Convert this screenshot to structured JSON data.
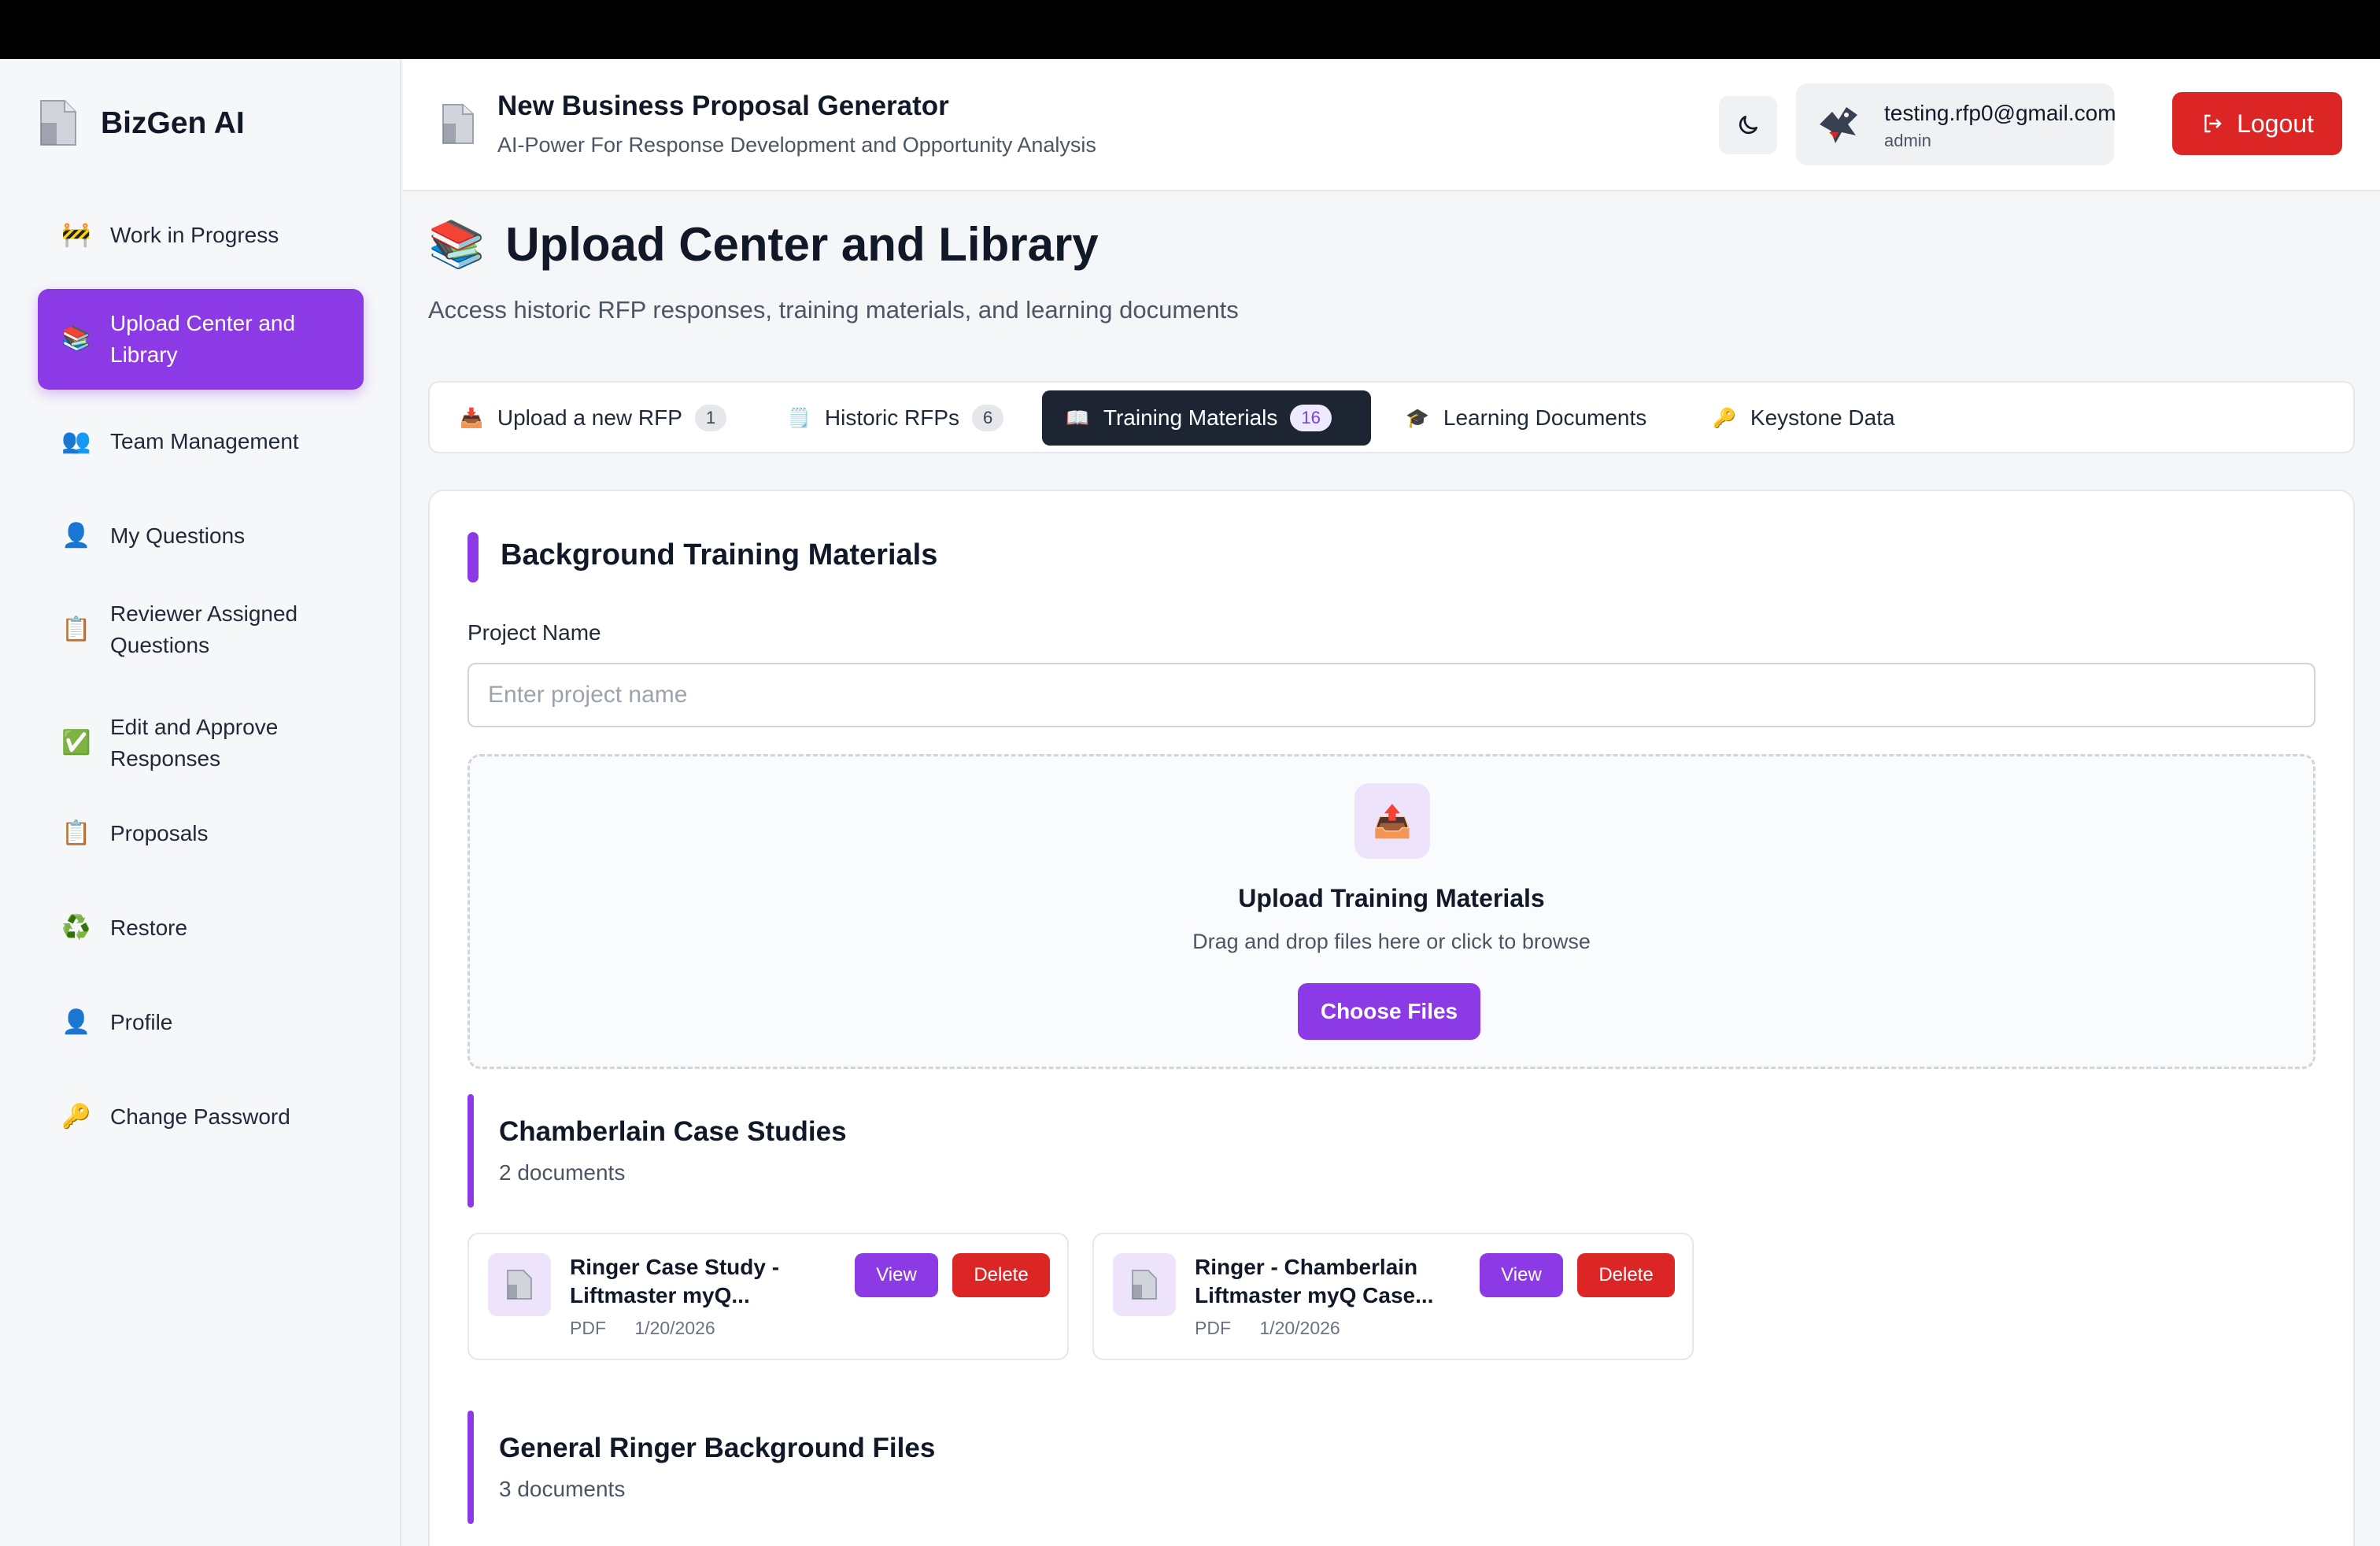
{
  "app": {
    "brand": "BizGen AI",
    "header_title": "New Business Proposal Generator",
    "header_subtitle": "AI-Power For Response Development and Opportunity Analysis"
  },
  "user": {
    "email": "testing.rfp0@gmail.com",
    "role": "admin",
    "logout_label": "Logout"
  },
  "sidebar": {
    "items": [
      {
        "label": "Work in Progress",
        "icon": "construction-icon",
        "glyph": "🚧",
        "active": false
      },
      {
        "label": "Upload Center and Library",
        "icon": "books-icon",
        "glyph": "📚",
        "active": true
      },
      {
        "label": "Team Management",
        "icon": "team-icon",
        "glyph": "👥",
        "active": false
      },
      {
        "label": "My Questions",
        "icon": "user-icon",
        "glyph": "👤",
        "active": false
      },
      {
        "label": "Reviewer Assigned Questions",
        "icon": "clipboard-icon",
        "glyph": "📋",
        "active": false
      },
      {
        "label": "Edit and Approve Responses",
        "icon": "check-icon",
        "glyph": "✅",
        "active": false
      },
      {
        "label": "Proposals",
        "icon": "clipboard-icon",
        "glyph": "📋",
        "active": false
      },
      {
        "label": "Restore",
        "icon": "recycle-icon",
        "glyph": "♻️",
        "active": false
      },
      {
        "label": "Profile",
        "icon": "user-icon",
        "glyph": "👤",
        "active": false
      },
      {
        "label": "Change Password",
        "icon": "key-icon",
        "glyph": "🔑",
        "active": false
      }
    ]
  },
  "page": {
    "icon": "books-icon",
    "title": "Upload Center and Library",
    "subtitle": "Access historic RFP responses, training materials, and learning documents"
  },
  "tabs": [
    {
      "label": "Upload a new RFP",
      "badge": "1",
      "icon": "inbox-tray-icon",
      "glyph": "📥",
      "active": false
    },
    {
      "label": "Historic RFPs",
      "badge": "6",
      "icon": "ledger-icon",
      "glyph": "🗒️",
      "active": false
    },
    {
      "label": "Training Materials",
      "badge": "16",
      "icon": "open-book-icon",
      "glyph": "📖",
      "active": true
    },
    {
      "label": "Learning Documents",
      "badge": null,
      "icon": "graduation-cap-icon",
      "glyph": "🎓",
      "active": false
    },
    {
      "label": "Keystone Data",
      "badge": null,
      "icon": "key-icon",
      "glyph": "🔑",
      "active": false
    }
  ],
  "section": {
    "title": "Background Training Materials",
    "project_label": "Project Name",
    "project_value": "",
    "project_placeholder": "Enter project name",
    "upload_title": "Upload Training Materials",
    "upload_hint": "Drag and drop files here or click to browse",
    "choose_label": "Choose Files"
  },
  "groups": [
    {
      "title": "Chamberlain Case Studies",
      "count": "2 documents",
      "docs": [
        {
          "name": "Ringer Case Study - Liftmaster myQ...",
          "type": "PDF",
          "date": "1/20/2026"
        },
        {
          "name": "Ringer - Chamberlain Liftmaster myQ Case...",
          "type": "PDF",
          "date": "1/20/2026"
        }
      ]
    },
    {
      "title": "General Ringer Background Files",
      "count": "3 documents",
      "docs": []
    }
  ],
  "buttons": {
    "view": "View",
    "delete": "Delete"
  },
  "colors": {
    "accent": "#8b3ae6",
    "danger": "#dc2626",
    "active_tab": "#1e2532"
  }
}
